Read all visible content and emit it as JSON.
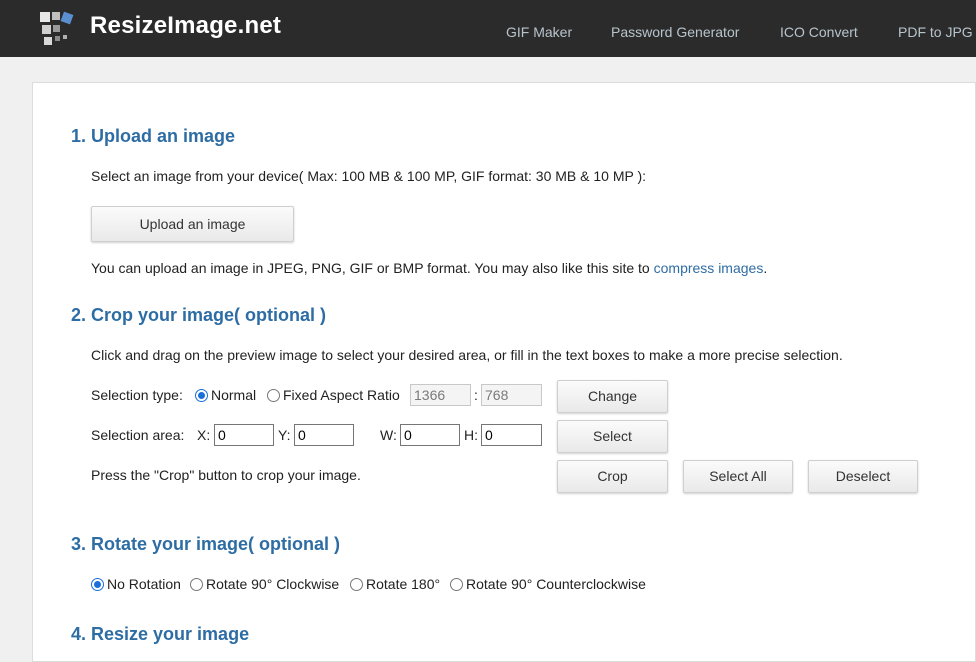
{
  "header": {
    "brand": "ResizeImage.net",
    "nav": [
      "GIF Maker",
      "Password Generator",
      "ICO Convert",
      "PDF to JPG"
    ]
  },
  "section1": {
    "title": "1. Upload an image",
    "instruction": "Select an image from your device( Max: 100 MB & 100 MP, GIF format: 30 MB & 10 MP ):",
    "upload_button": "Upload an image",
    "note_prefix": "You can upload an image in JPEG, PNG, GIF or BMP format. You may also like this site to ",
    "note_link": "compress images",
    "note_suffix": "."
  },
  "section2": {
    "title": "2. Crop your image( optional )",
    "instruction": "Click and drag on the preview image to select your desired area, or fill in the text boxes to make a more precise selection.",
    "selection_type_label": "Selection type:",
    "radio_normal": "Normal",
    "radio_fixed": "Fixed Aspect Ratio",
    "ratio_w": "1366",
    "ratio_sep": ":",
    "ratio_h": "768",
    "change_button": "Change",
    "selection_area_label": "Selection area:",
    "x_label": "X:",
    "x_value": "0",
    "y_label": "Y:",
    "y_value": "0",
    "w_label": "W:",
    "w_value": "0",
    "h_label": "H:",
    "h_value": "0",
    "select_button": "Select",
    "crop_note": "Press the \"Crop\" button to crop your image.",
    "crop_button": "Crop",
    "select_all_button": "Select All",
    "deselect_button": "Deselect"
  },
  "section3": {
    "title": "3. Rotate your image( optional )",
    "options": [
      "No Rotation",
      "Rotate 90° Clockwise",
      "Rotate 180°",
      "Rotate 90° Counterclockwise"
    ]
  },
  "section4": {
    "title": "4. Resize your image"
  }
}
